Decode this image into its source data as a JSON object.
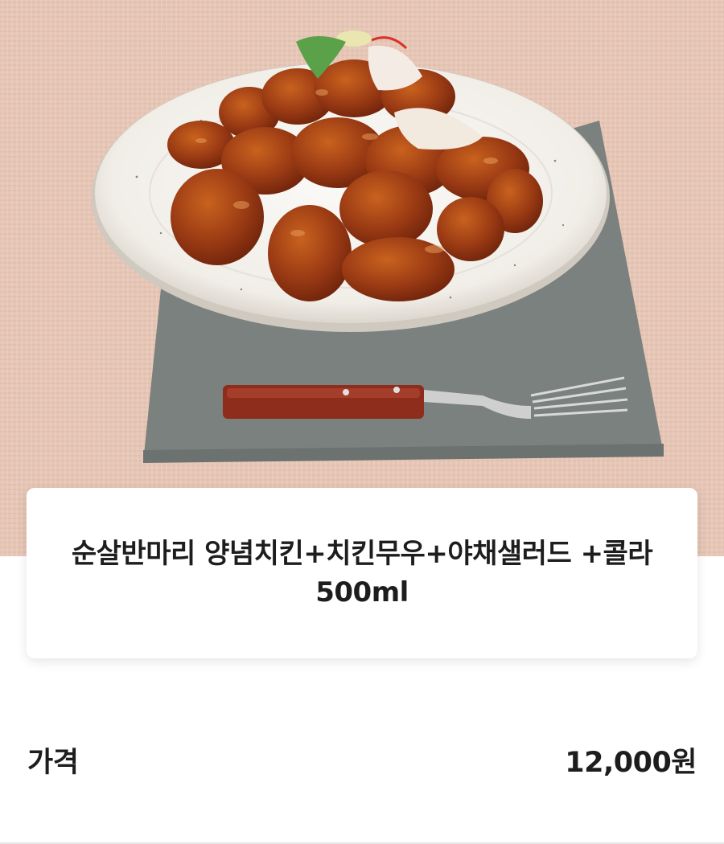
{
  "product": {
    "image_alt": "chicken-photo",
    "title": "순살반마리 양념치킨+치킨무우+야채샐러드 +콜라500ml"
  },
  "price": {
    "label": "가격",
    "value": "12,000원"
  },
  "colors": {
    "tablecloth": "#e8c8b8",
    "napkin": "#7b817e",
    "plate": "#f6f4f0",
    "chicken": "#9a3a14",
    "text": "#1d1d1d"
  }
}
